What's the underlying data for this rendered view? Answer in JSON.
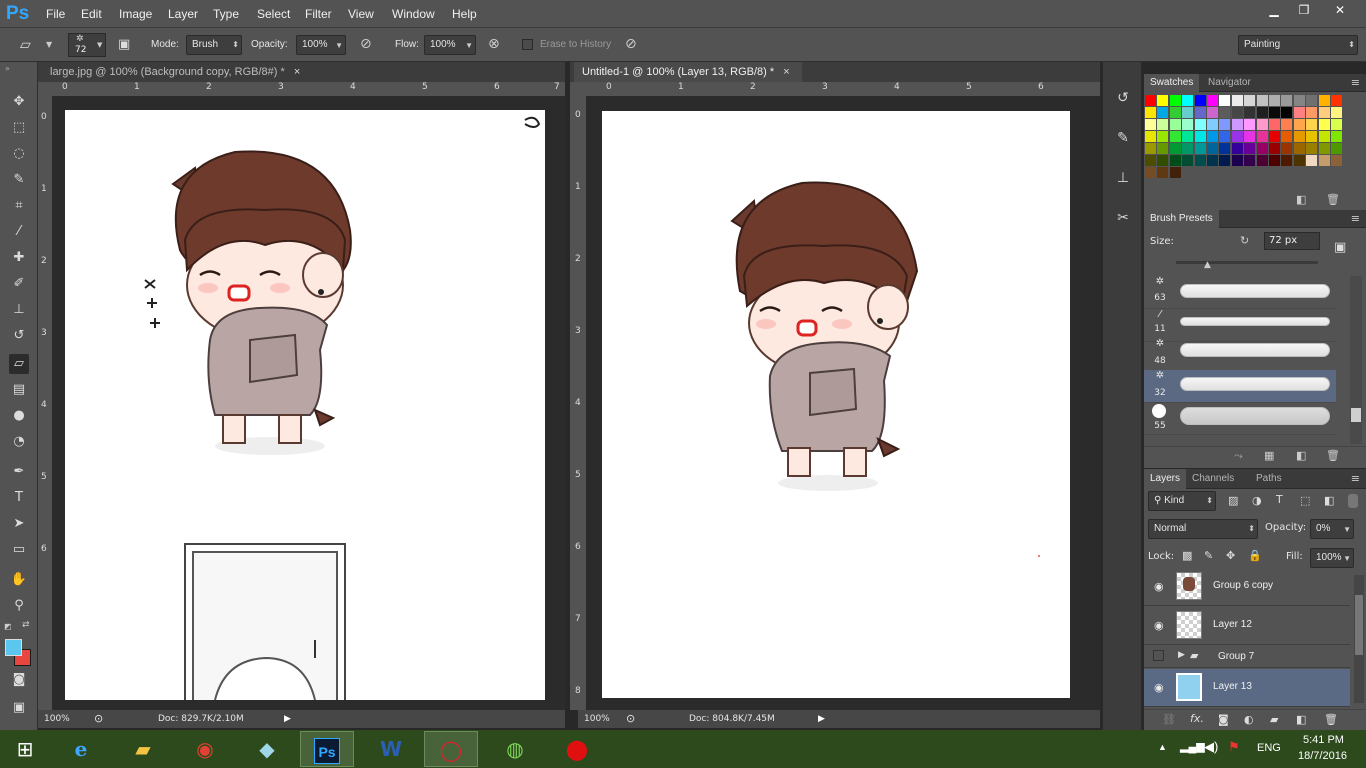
{
  "app": {
    "logo": "Ps"
  },
  "menu": [
    "File",
    "Edit",
    "Image",
    "Layer",
    "Type",
    "Select",
    "Filter",
    "View",
    "Window",
    "Help"
  ],
  "window_controls": {
    "minimize": "▁",
    "restore": "❐",
    "close": "✕"
  },
  "options": {
    "brush_size": "72",
    "mode_label": "Mode:",
    "mode_value": "Brush",
    "opacity_label": "Opacity:",
    "opacity_value": "100%",
    "flow_label": "Flow:",
    "flow_value": "100%",
    "erase_history": "Erase to History",
    "workspace": "Painting"
  },
  "documents": [
    {
      "title": "large.jpg @ 100% (Background copy, RGB/8#) *",
      "zoom": "100%",
      "doc": "Doc: 829.7K/2.10M",
      "ruler_h": [
        "0",
        "1",
        "2",
        "3",
        "4",
        "5",
        "6",
        "7"
      ],
      "ruler_v": [
        "0",
        "1",
        "2",
        "3",
        "4",
        "5",
        "6"
      ]
    },
    {
      "title": "Untitled-1 @ 100% (Layer 13, RGB/8) *",
      "zoom": "100%",
      "doc": "Doc: 804.8K/7.45M",
      "ruler_h": [
        "0",
        "1",
        "2",
        "3",
        "4",
        "5",
        "6"
      ],
      "ruler_v": [
        "0",
        "1",
        "2",
        "3",
        "4",
        "5",
        "6",
        "7",
        "8"
      ]
    }
  ],
  "close_glyph": "×",
  "swatches_panel": {
    "tabs": [
      "Swatches",
      "Navigator"
    ],
    "colors": [
      "#ff0000",
      "#ffff00",
      "#00ff00",
      "#00ffff",
      "#0000ff",
      "#ff00ff",
      "#ffffff",
      "#ebebeb",
      "#d6d6d6",
      "#c2c2c2",
      "#adadad",
      "#999999",
      "#858585",
      "#707070",
      "#ffb200",
      "#ff3300",
      "#ffe600",
      "#00a8e6",
      "#33cc33",
      "#66cccc",
      "#6666cc",
      "#cc66cc",
      "#5c5c5c",
      "#474747",
      "#333333",
      "#1f1f1f",
      "#0a0a0a",
      "#000000",
      "#ff8080",
      "#ff9966",
      "#ffcc80",
      "#fff580",
      "#ffff99",
      "#ccff99",
      "#99ff99",
      "#99ffcc",
      "#80ffff",
      "#80ccff",
      "#8099ff",
      "#cc99ff",
      "#ff99ff",
      "#ff99cc",
      "#ff6666",
      "#ff7f50",
      "#ffa64d",
      "#ffd24d",
      "#ffff4d",
      "#d9ff4d",
      "#e6e600",
      "#99e600",
      "#33e633",
      "#00e699",
      "#00e6e6",
      "#0099e6",
      "#3366e6",
      "#9933e6",
      "#e633e6",
      "#e63399",
      "#e60000",
      "#e65c00",
      "#e69900",
      "#e6c200",
      "#c2e600",
      "#80e600",
      "#999900",
      "#669900",
      "#009933",
      "#009966",
      "#009999",
      "#006699",
      "#003399",
      "#330099",
      "#660099",
      "#990066",
      "#990000",
      "#993300",
      "#996600",
      "#998000",
      "#809900",
      "#4d9900",
      "#4d4d00",
      "#334d00",
      "#004d1a",
      "#004d33",
      "#004d4d",
      "#00334d",
      "#001a4d",
      "#1a004d",
      "#33004d",
      "#4d0033",
      "#4d0000",
      "#4d1a00",
      "#4d3300",
      "#f0d9c0",
      "#c69c6d",
      "#8c6239",
      "#754c24",
      "#603913",
      "#42210b"
    ]
  },
  "brush_presets": {
    "title": "Brush Presets",
    "size_label": "Size:",
    "size_value": "72 px",
    "brushes": [
      {
        "num": "63"
      },
      {
        "num": "11"
      },
      {
        "num": "48"
      },
      {
        "num": "32"
      },
      {
        "num": "55"
      }
    ]
  },
  "layers_panel": {
    "tabs": [
      "Layers",
      "Channels",
      "Paths"
    ],
    "kind_label": "Kind",
    "blend_mode": "Normal",
    "opacity_label": "Opacity:",
    "opacity_value": "0%",
    "lock_label": "Lock:",
    "fill_label": "Fill:",
    "fill_value": "100%",
    "layers": [
      {
        "name": "Group 6 copy"
      },
      {
        "name": "Layer 12"
      },
      {
        "name": "Group 7"
      },
      {
        "name": "Layer 13"
      }
    ]
  },
  "taskbar": {
    "lang": "ENG",
    "time": "5:41 PM",
    "date": "18/7/2016"
  }
}
